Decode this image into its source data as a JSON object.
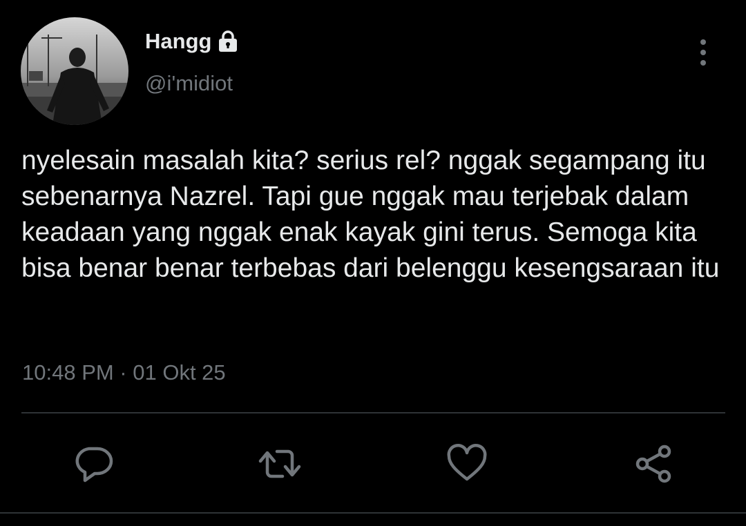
{
  "user": {
    "display_name": "Hangg",
    "handle": "@i'midiot",
    "protected_icon": "lock-icon",
    "avatar_icon": "avatar"
  },
  "tweet": {
    "text": "nyelesain masalah kita? serius rel? nggak segampang itu sebenarnya Nazrel. Tapi gue nggak mau terjebak dalam keadaan yang nggak enak kayak gini terus. Semoga kita bisa benar benar terbebas dari belenggu kesengsaraan itu",
    "timestamp": "10:48 PM · 01 Okt 25"
  },
  "header": {
    "more_icon": "more-vertical-icon"
  },
  "actions": [
    {
      "name": "reply",
      "icon": "reply-icon"
    },
    {
      "name": "retweet",
      "icon": "retweet-icon"
    },
    {
      "name": "like",
      "icon": "heart-icon"
    },
    {
      "name": "share",
      "icon": "share-icon"
    }
  ],
  "colors": {
    "background": "#000000",
    "primary_text": "#e7e9ea",
    "secondary_text": "#71767b",
    "icon": "#71767b",
    "divider": "#2f3336"
  }
}
